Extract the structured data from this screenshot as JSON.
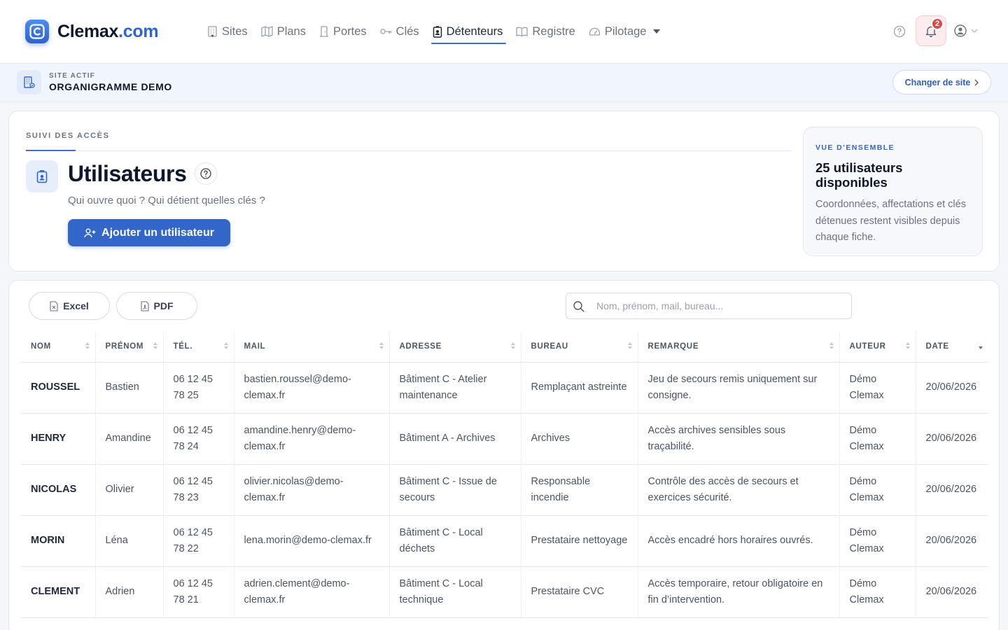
{
  "brand": {
    "name": "Clemax",
    "tld": ".com"
  },
  "nav": [
    {
      "label": "Sites",
      "icon": "building-icon"
    },
    {
      "label": "Plans",
      "icon": "map-icon"
    },
    {
      "label": "Portes",
      "icon": "door-icon"
    },
    {
      "label": "Clés",
      "icon": "key-icon"
    },
    {
      "label": "Détenteurs",
      "icon": "badge-icon",
      "active": true
    },
    {
      "label": "Registre",
      "icon": "book-icon"
    },
    {
      "label": "Pilotage",
      "icon": "gauge-icon",
      "dropdown": true
    }
  ],
  "notifications": {
    "count": "2"
  },
  "site": {
    "label": "SITE ACTIF",
    "name": "ORGANIGRAMME DEMO",
    "change_label": "Changer de site"
  },
  "header": {
    "kicker": "SUIVI DES ACCÈS",
    "title": "Utilisateurs",
    "subtitle": "Qui ouvre quoi ? Qui détient quelles clés ?",
    "add_button": "Ajouter un utilisateur"
  },
  "overview": {
    "kicker": "VUE D’ENSEMBLE",
    "title": "25 utilisateurs disponibles",
    "text": "Coordonnées, affectations et clés détenues restent visibles depuis chaque fiche."
  },
  "toolbar": {
    "excel_label": "Excel",
    "pdf_label": "PDF",
    "search_placeholder": "Nom, prénom, mail, bureau..."
  },
  "table": {
    "columns": [
      "NOM",
      "PRÉNOM",
      "TÉL.",
      "MAIL",
      "ADRESSE",
      "BUREAU",
      "REMARQUE",
      "AUTEUR",
      "DATE"
    ],
    "rows": [
      {
        "nom": "ROUSSEL",
        "prenom": "Bastien",
        "tel": "06 12 45 78 25",
        "mail": "bastien.roussel@demo-clemax.fr",
        "adresse": "Bâtiment C - Atelier maintenance",
        "bureau": "Remplaçant astreinte",
        "remarque": "Jeu de secours remis uniquement sur consigne.",
        "auteur": "Démo Clemax",
        "date": "20/06/2026"
      },
      {
        "nom": "HENRY",
        "prenom": "Amandine",
        "tel": "06 12 45 78 24",
        "mail": "amandine.henry@demo-clemax.fr",
        "adresse": "Bâtiment A - Archives",
        "bureau": "Archives",
        "remarque": "Accès archives sensibles sous traçabilité.",
        "auteur": "Démo Clemax",
        "date": "20/06/2026"
      },
      {
        "nom": "NICOLAS",
        "prenom": "Olivier",
        "tel": "06 12 45 78 23",
        "mail": "olivier.nicolas@demo-clemax.fr",
        "adresse": "Bâtiment C - Issue de secours",
        "bureau": "Responsable incendie",
        "remarque": "Contrôle des accès de secours et exercices sécurité.",
        "auteur": "Démo Clemax",
        "date": "20/06/2026"
      },
      {
        "nom": "MORIN",
        "prenom": "Léna",
        "tel": "06 12 45 78 22",
        "mail": "lena.morin@demo-clemax.fr",
        "adresse": "Bâtiment C - Local déchets",
        "bureau": "Prestataire nettoyage",
        "remarque": "Accès encadré hors horaires ouvrés.",
        "auteur": "Démo Clemax",
        "date": "20/06/2026"
      },
      {
        "nom": "CLEMENT",
        "prenom": "Adrien",
        "tel": "06 12 45 78 21",
        "mail": "adrien.clement@demo-clemax.fr",
        "adresse": "Bâtiment C - Local technique",
        "bureau": "Prestataire CVC",
        "remarque": "Accès temporaire, retour obligatoire en fin d’intervention.",
        "auteur": "Démo Clemax",
        "date": "20/06/2026"
      }
    ]
  }
}
